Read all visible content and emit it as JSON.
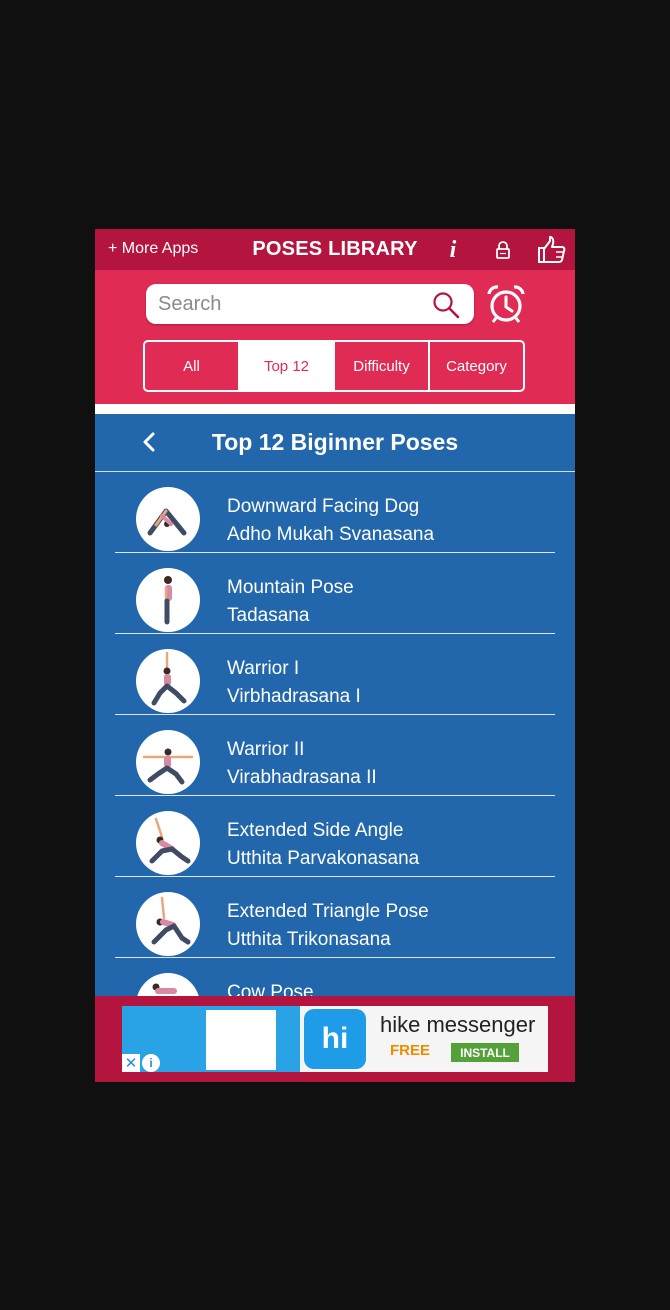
{
  "topbar": {
    "more_apps": "+ More Apps",
    "title": "POSES LIBRARY",
    "info_glyph": "i",
    "icons": [
      "info-icon",
      "lock-icon",
      "thumbs-up-icon"
    ]
  },
  "search": {
    "placeholder": "Search"
  },
  "tabs": [
    "All",
    "Top 12",
    "Difficulty",
    "Category"
  ],
  "active_tab": "Top 12",
  "list": {
    "title": "Top 12 Biginner Poses",
    "items": [
      {
        "name": "Downward Facing Dog",
        "sanskrit": "Adho Mukah Svanasana"
      },
      {
        "name": "Mountain Pose",
        "sanskrit": "Tadasana"
      },
      {
        "name": "Warrior I",
        "sanskrit": "Virbhadrasana I"
      },
      {
        "name": "Warrior II",
        "sanskrit": "Virabhadrasana II"
      },
      {
        "name": "Extended Side Angle",
        "sanskrit": "Utthita Parvakonasana"
      },
      {
        "name": "Extended Triangle Pose",
        "sanskrit": "Utthita Trikonasana"
      },
      {
        "name": "Cow Pose",
        "sanskrit": ""
      }
    ]
  },
  "ad": {
    "app_name": "hike messenger",
    "price": "FREE",
    "cta": "INSTALL",
    "logo_text": "hi",
    "close_glyph": "✕",
    "info_glyph": "i"
  },
  "colors": {
    "brand": "#e02b55",
    "topbar": "#b3153f",
    "list_bg": "#2266ab",
    "install_green": "#54a13a"
  }
}
